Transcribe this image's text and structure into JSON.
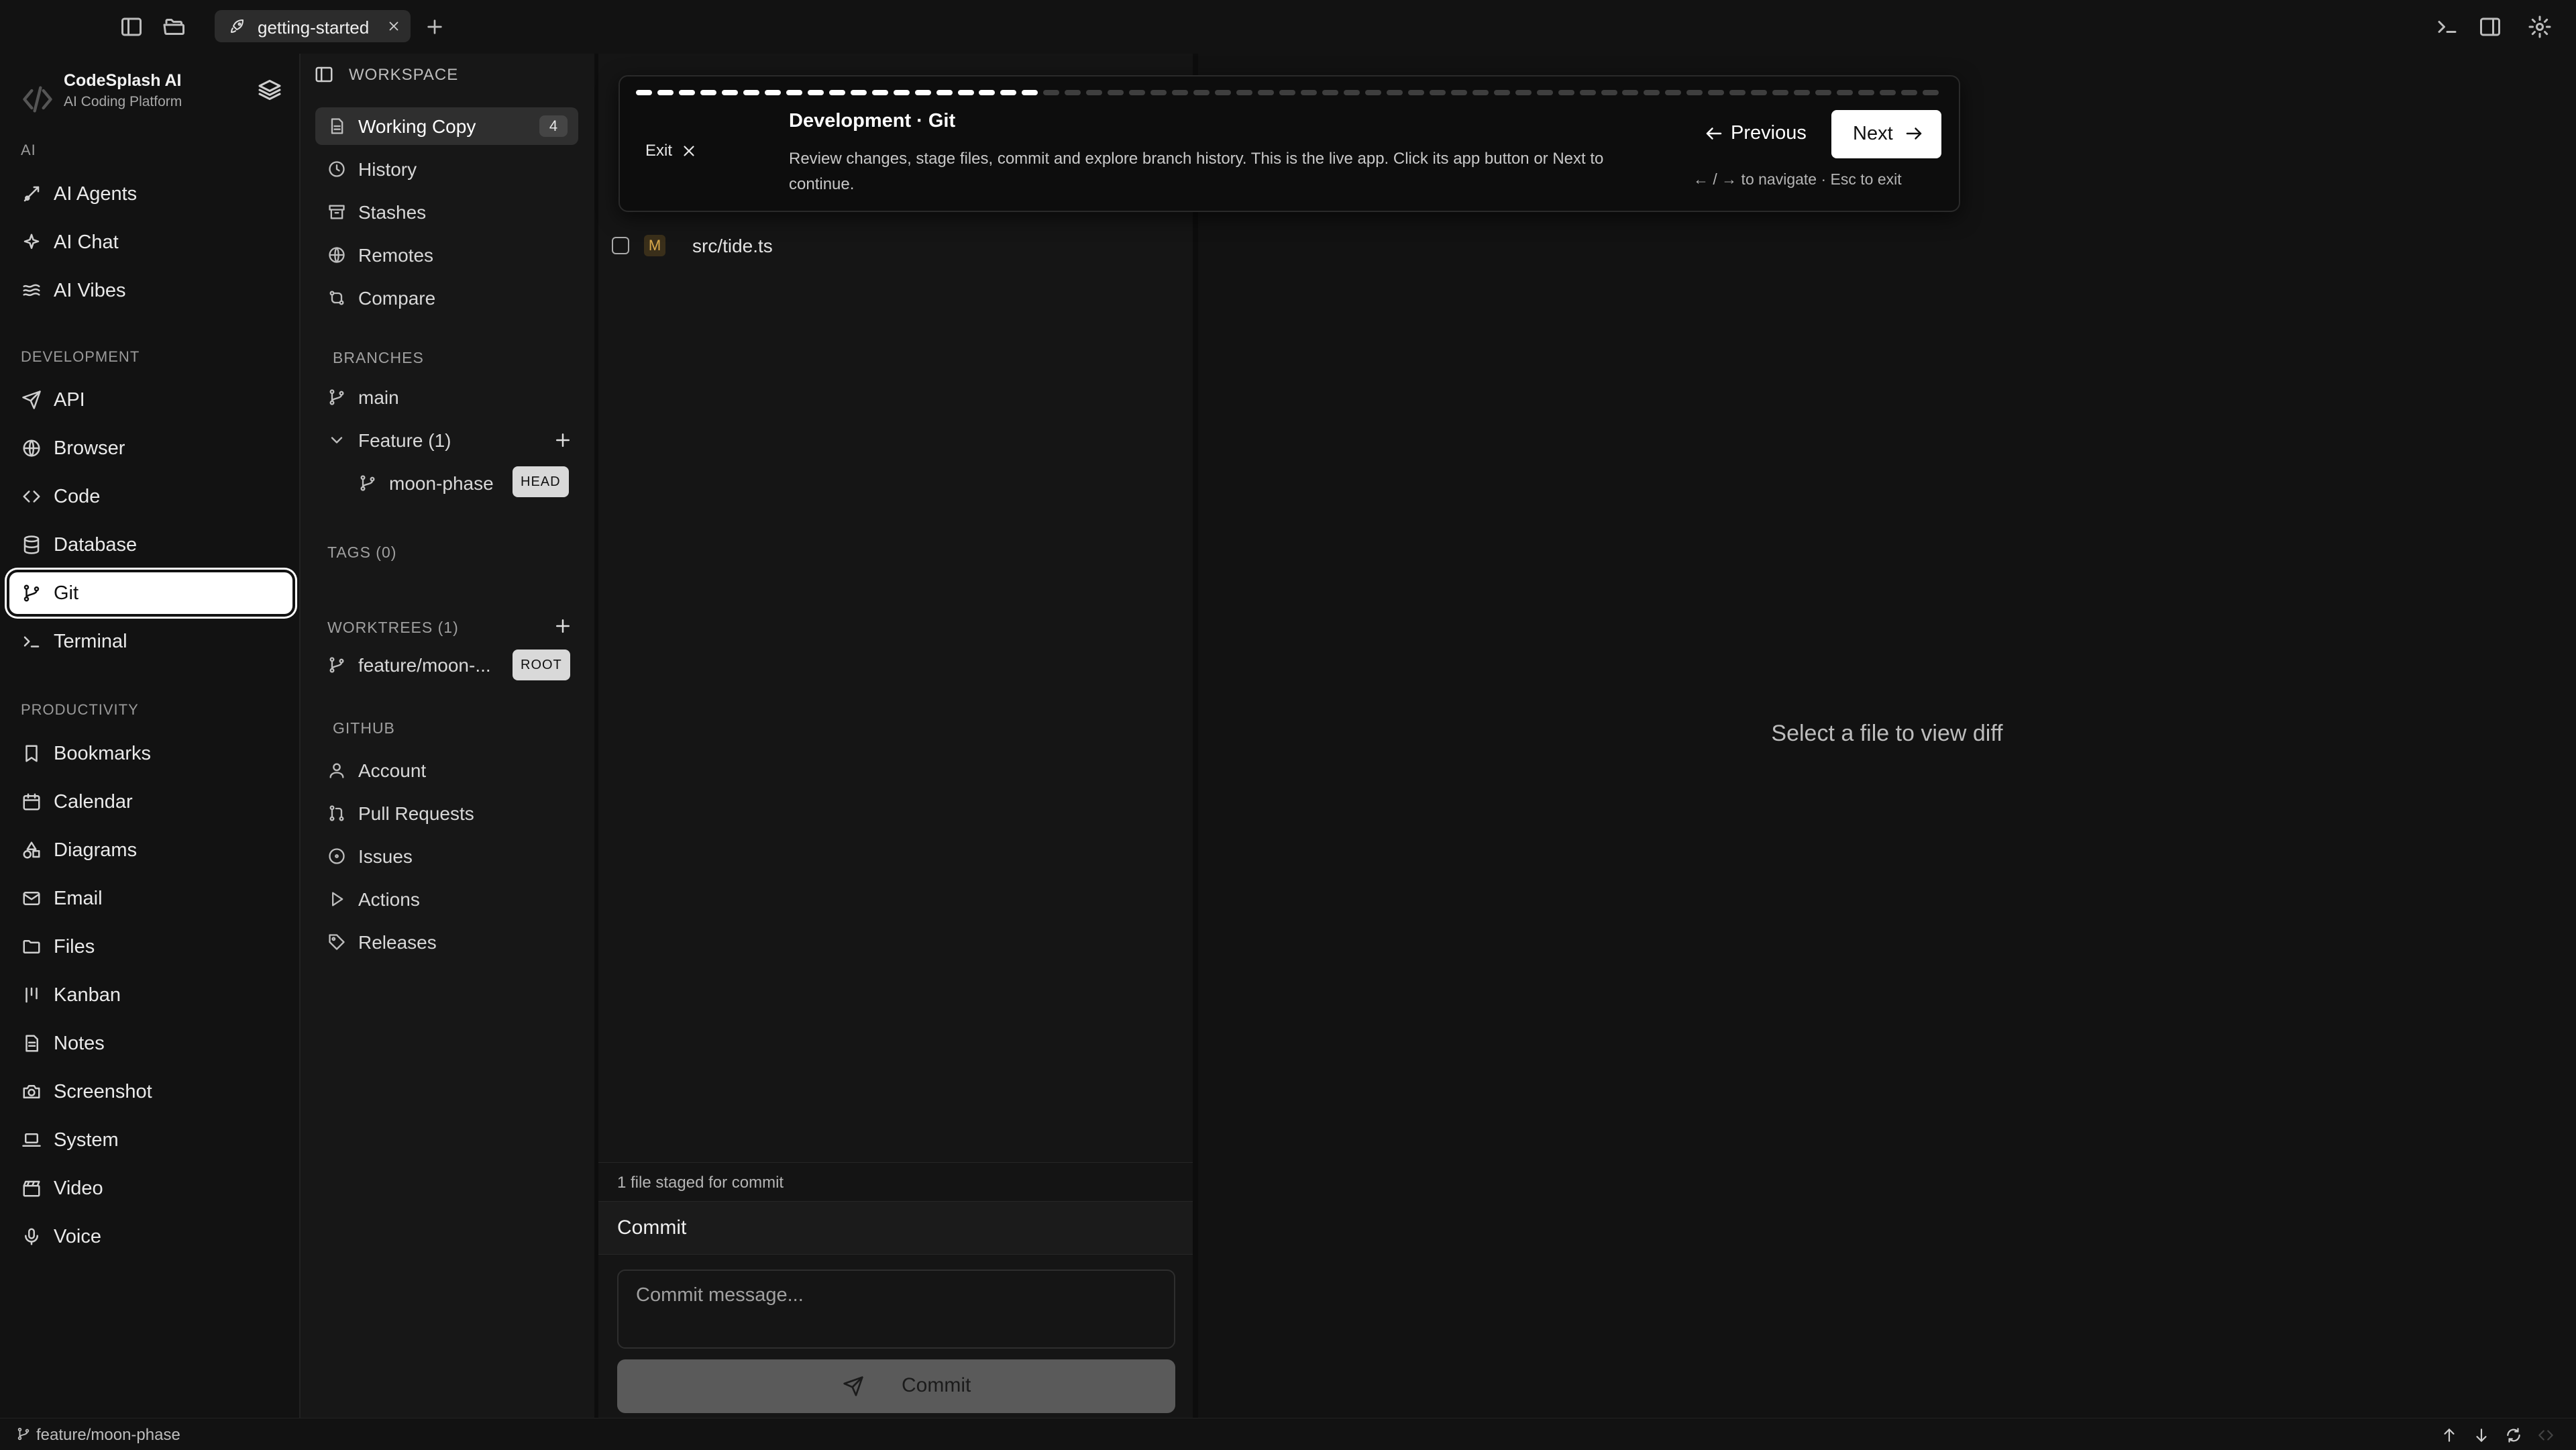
{
  "tabs": [
    {
      "label": "getting-started"
    }
  ],
  "app": {
    "name": "CodeSplash AI",
    "subtitle": "AI Coding Platform"
  },
  "sidebar": {
    "sections": [
      {
        "label": "AI",
        "items": [
          {
            "label": "AI Agents",
            "icon": "bot-icon"
          },
          {
            "label": "AI Chat",
            "icon": "sparkle-icon"
          },
          {
            "label": "AI Vibes",
            "icon": "waves-icon"
          }
        ]
      },
      {
        "label": "DEVELOPMENT",
        "items": [
          {
            "label": "API",
            "icon": "send-icon"
          },
          {
            "label": "Browser",
            "icon": "globe-icon"
          },
          {
            "label": "Code",
            "icon": "code-icon"
          },
          {
            "label": "Database",
            "icon": "database-icon"
          },
          {
            "label": "Git",
            "icon": "git-branch-icon",
            "active": true
          },
          {
            "label": "Terminal",
            "icon": "terminal-icon"
          }
        ]
      },
      {
        "label": "PRODUCTIVITY",
        "items": [
          {
            "label": "Bookmarks",
            "icon": "bookmark-icon"
          },
          {
            "label": "Calendar",
            "icon": "calendar-icon"
          },
          {
            "label": "Diagrams",
            "icon": "shapes-icon"
          },
          {
            "label": "Email",
            "icon": "mail-icon"
          },
          {
            "label": "Files",
            "icon": "folder-icon"
          },
          {
            "label": "Kanban",
            "icon": "kanban-icon"
          },
          {
            "label": "Notes",
            "icon": "note-icon"
          },
          {
            "label": "Screenshot",
            "icon": "camera-icon"
          },
          {
            "label": "System",
            "icon": "laptop-icon"
          },
          {
            "label": "Video",
            "icon": "clapper-icon"
          },
          {
            "label": "Voice",
            "icon": "mic-icon"
          }
        ]
      }
    ]
  },
  "git": {
    "workspace_label": "WORKSPACE",
    "workspace_items": [
      {
        "label": "Working Copy",
        "count": "4"
      },
      {
        "label": "History"
      },
      {
        "label": "Stashes"
      },
      {
        "label": "Remotes"
      },
      {
        "label": "Compare"
      }
    ],
    "branches_label": "BRANCHES",
    "branch_main": "main",
    "branch_group": "Feature (1)",
    "branch_child": "moon-phase",
    "head_badge": "HEAD",
    "tags_label": "TAGS (0)",
    "worktrees_label": "WORKTREES (1)",
    "worktree_item": "feature/moon-...",
    "root_badge": "ROOT",
    "github_label": "GITHUB",
    "github_items": [
      {
        "label": "Account"
      },
      {
        "label": "Pull Requests"
      },
      {
        "label": "Issues"
      },
      {
        "label": "Actions"
      },
      {
        "label": "Releases"
      }
    ]
  },
  "changes": {
    "files": [
      {
        "status": "M",
        "path": "src/tide.ts",
        "checked": false
      }
    ],
    "staged_text": "1 file staged for commit",
    "commit_title": "Commit",
    "commit_placeholder": "Commit message...",
    "commit_button": "Commit"
  },
  "diff": {
    "empty_text": "Select a file to view diff"
  },
  "tour": {
    "exit_label": "Exit",
    "title": "Development · Git",
    "description": "Review changes, stage files, commit and explore branch history. This is the live app. Click its app button or Next to continue.",
    "prev_label": "Previous",
    "next_label": "Next",
    "hint": "← / → to navigate · Esc to exit",
    "progress_total": 61,
    "progress_done": 19
  },
  "status": {
    "branch": "feature/moon-phase"
  },
  "colors": {
    "accent": "#ffffff",
    "background": "#121212",
    "modified": "#d9a94b"
  }
}
